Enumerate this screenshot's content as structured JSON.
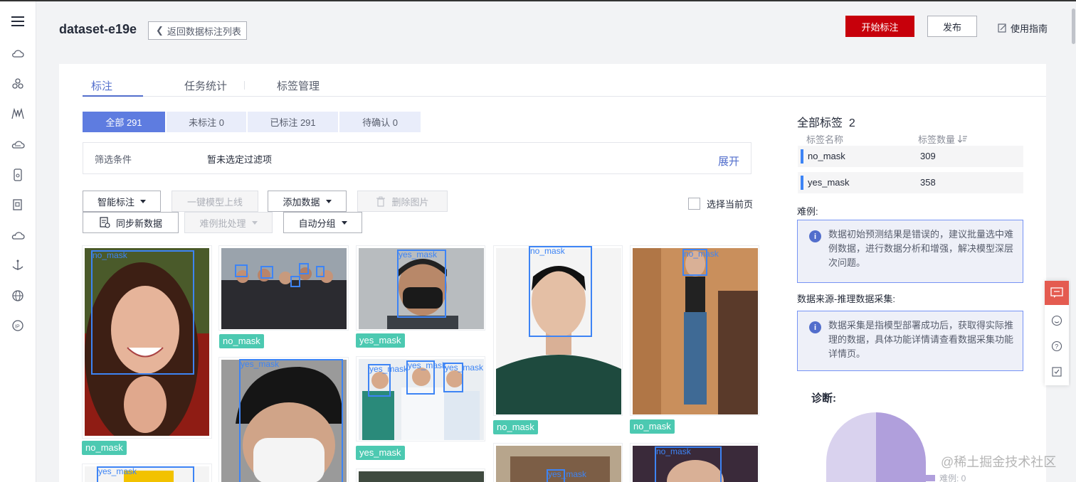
{
  "header": {
    "dataset_name": "dataset-e19e",
    "back_label": "返回数据标注列表",
    "start_label": "开始标注",
    "publish_label": "发布",
    "guide_label": "使用指南"
  },
  "tabs": [
    {
      "label": "标注",
      "active": true
    },
    {
      "label": "任务统计",
      "active": false
    },
    {
      "label": "标签管理",
      "active": false
    }
  ],
  "status_filters": [
    {
      "label": "全部 291",
      "active": true
    },
    {
      "label": "未标注 0",
      "active": false
    },
    {
      "label": "已标注 291",
      "active": false
    },
    {
      "label": "待确认 0",
      "active": false
    }
  ],
  "filter": {
    "label": "筛选条件",
    "value": "暂未选定过滤项",
    "expand_label": "展开"
  },
  "toolbar": {
    "smart_label": "智能标注",
    "one_click_label": "一键模型上线",
    "add_data_label": "添加数据",
    "delete_label": "删除图片",
    "sync_label": "同步新数据",
    "hard_label": "难例批处理",
    "auto_group_label": "自动分组",
    "select_page_label": "选择当前页"
  },
  "images": [
    {
      "tag": "no_mask",
      "boxes": [
        "no_mask"
      ]
    },
    {
      "tag": "no_mask",
      "boxes": []
    },
    {
      "tag": "yes_mask",
      "boxes": [
        "yes_mask"
      ]
    },
    {
      "tag": "no_mask",
      "boxes": [
        "no_mask"
      ]
    },
    {
      "tag": "no_mask",
      "boxes": [
        "no_mask"
      ]
    },
    {
      "tag": "",
      "boxes": [
        "yes_mask"
      ]
    },
    {
      "tag": "yes_mask",
      "boxes": [
        "yes_mask",
        "yes_mask",
        "yes_mask"
      ]
    },
    {
      "tag": "",
      "boxes": [
        "yes_mask"
      ]
    },
    {
      "tag": "",
      "boxes": [
        "no_mask"
      ]
    },
    {
      "tag": "",
      "boxes": [
        "yes_mask"
      ]
    }
  ],
  "right_panel": {
    "all_labels_title": "全部标签",
    "all_labels_count": "2",
    "col_name": "标签名称",
    "col_count": "标签数量",
    "labels": [
      {
        "name": "no_mask",
        "count": "309",
        "color": "#3d84f5"
      },
      {
        "name": "yes_mask",
        "count": "358",
        "color": "#3d84f5"
      }
    ],
    "hard_title": "难例:",
    "hard_info": "数据初始预测结果是错误的，建议批量选中难例数据，进行数据分析和增强，解决模型深层次问题。",
    "source_title": "数据来源-推理数据采集:",
    "source_info": "数据采集是指模型部署成功后，获取得实际推理的数据，具体功能详情请查看数据采集功能详情页。",
    "diagnosis_title": "诊断:",
    "legend_label": "难例: 0"
  },
  "watermark": "@稀土掘金技术社区",
  "colors": {
    "accent": "#526ecc",
    "primary_button": "#c7000b",
    "tag": "#4cc9b1",
    "bbox": "#3d84f5",
    "pie_a": "#b09fdc",
    "pie_b": "#d9d2ee"
  }
}
